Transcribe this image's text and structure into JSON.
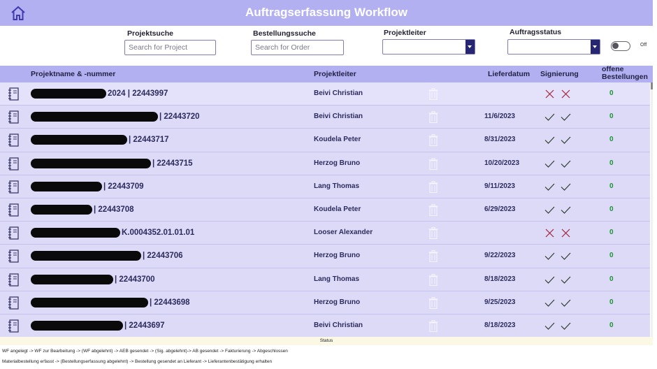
{
  "app": {
    "title": "Auftragserfassung Workflow",
    "header_color": "#b3b0f2"
  },
  "filters": {
    "project_search": {
      "label": "Projektsuche",
      "placeholder": "Search for Project",
      "value": ""
    },
    "order_search": {
      "label": "Bestellungssuche",
      "placeholder": "Search for Order",
      "value": ""
    },
    "project_leader": {
      "label": "Projektleiter",
      "value": ""
    },
    "order_status": {
      "label": "Auftragsstatus",
      "value": ""
    },
    "toggle": {
      "label": "Off",
      "state": "off"
    }
  },
  "columns": {
    "name": "Projektname & -nummer",
    "leader": "Projektleiter",
    "date": "Lieferdatum",
    "signing": "Signierung",
    "open_orders_line1": "offene",
    "open_orders_line2": "Bestellungen"
  },
  "rows": [
    {
      "name_visible": "2024 | 22443997",
      "leader": "Beivi Christian",
      "date": "",
      "sig": [
        "cross",
        "cross"
      ],
      "open": "0"
    },
    {
      "name_visible": "| 22443720",
      "leader": "Beivi Christian",
      "date": "11/6/2023",
      "sig": [
        "check",
        "check"
      ],
      "open": "0"
    },
    {
      "name_visible": "| 22443717",
      "leader": "Koudela Peter",
      "date": "8/31/2023",
      "sig": [
        "check",
        "check"
      ],
      "open": "0"
    },
    {
      "name_visible": "| 22443715",
      "leader": "Herzog Bruno",
      "date": "10/20/2023",
      "sig": [
        "check",
        "check"
      ],
      "open": "0"
    },
    {
      "name_visible": "| 22443709",
      "leader": "Lang Thomas",
      "date": "9/11/2023",
      "sig": [
        "check",
        "check"
      ],
      "open": "0"
    },
    {
      "name_visible": "| 22443708",
      "leader": "Koudela Peter",
      "date": "6/29/2023",
      "sig": [
        "check",
        "check"
      ],
      "open": "0"
    },
    {
      "name_visible": "K.0004352.01.01.01",
      "leader": "Looser Alexander",
      "date": "",
      "sig": [
        "cross",
        "cross"
      ],
      "open": "0"
    },
    {
      "name_visible": "| 22443706",
      "leader": "Herzog Bruno",
      "date": "9/22/2023",
      "sig": [
        "check",
        "check"
      ],
      "open": "0"
    },
    {
      "name_visible": "| 22443700",
      "leader": "Lang Thomas",
      "date": "8/18/2023",
      "sig": [
        "check",
        "check"
      ],
      "open": "0"
    },
    {
      "name_visible": "| 22443698",
      "leader": "Herzog Bruno",
      "date": "9/25/2023",
      "sig": [
        "check",
        "check"
      ],
      "open": "0"
    },
    {
      "name_visible": "| 22443697",
      "leader": "Beivi Christian",
      "date": "8/18/2023",
      "sig": [
        "check",
        "check"
      ],
      "open": "0"
    }
  ],
  "status": {
    "label": "Status",
    "workflow_line": "WF angelegt -> WF zur Bearbeitung -> (WF abgelehnt) -> AEB gesendet -> (Sig. abgelehnt)-> AB gesendet -> Fakturierung -> Abgeschlossen",
    "order_line": "Materialbestellung erfasst -> (Bestellungserfassung abgelehnt) -> Bestellung gesendet an Lieferant -> Lieferantenbestätigung erhalten"
  },
  "icons": {
    "home": "home-icon",
    "row": "notebook-icon",
    "delete": "trash-icon",
    "signed": "check-icon",
    "rejected": "cross-icon",
    "dropdown": "chevron-down-icon"
  },
  "colors": {
    "accent": "#b3b0f2",
    "row_bg": "#dcdaf6",
    "dropdown_button": "#262673",
    "check": "#2f3d2f",
    "cross": "#a3213a",
    "open_count": "#17962e"
  }
}
